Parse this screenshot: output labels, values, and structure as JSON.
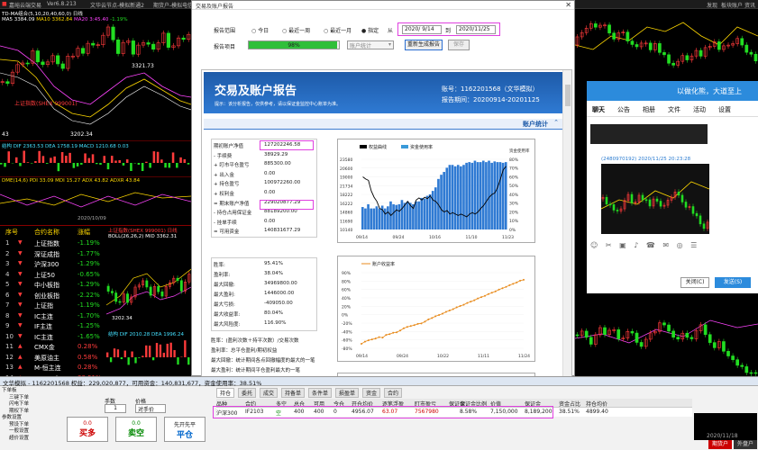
{
  "titlebar": {
    "app": "嘉峪云端交易",
    "version": "Ver6.8.213",
    "tab1": "文华云节点-模拟新通2",
    "tab2": "期货户-模拟电信",
    "dialog": "交易及账户报告",
    "right_links": [
      "发现",
      "板块",
      "账户",
      "资讯"
    ]
  },
  "left_chart": {
    "header": "TD-MA组合(5,10,20,40,60,0)  日线",
    "ma5": "MA5 3384.09",
    "ma10": "MA10 3362.84",
    "ma20": "MA20 3:45.40",
    "pct": "-1.19%",
    "index": "上证指数(SHEX 999001)",
    "price": "3321.73",
    "lbl1": "3202.34",
    "macd": "结构 DIF 2363.53  DEA 1758.19  MACD 1210.68  0.03",
    "macd_val": "43",
    "dmi": "DME(14,6)  PDI 33.09  MDI 15.27  ADX 43.82  ADXR 43.84",
    "date": "2020/10/09"
  },
  "watchlist": {
    "cols": [
      "序号",
      "合约名称",
      "涨幅"
    ],
    "rows": [
      {
        "n": "1",
        "name": "上证指数",
        "chg": "-1.19%"
      },
      {
        "n": "2",
        "name": "深证成指",
        "chg": "-1.77%"
      },
      {
        "n": "3",
        "name": "沪深300",
        "chg": "-1.29%"
      },
      {
        "n": "4",
        "name": "上证50",
        "chg": "-0.65%"
      },
      {
        "n": "5",
        "name": "中小板指",
        "chg": "-1.29%"
      },
      {
        "n": "6",
        "name": "创业板指",
        "chg": "-2.22%"
      },
      {
        "n": "7",
        "name": "上证指",
        "chg": "-1.19%"
      },
      {
        "n": "8",
        "name": "IC主连",
        "chg": "-1.70%"
      },
      {
        "n": "9",
        "name": "IF主连",
        "chg": "-1.25%"
      },
      {
        "n": "10",
        "name": "IC主连",
        "chg": "-1.65%"
      },
      {
        "n": "11",
        "name": "CMX金",
        "chg": "0.28%"
      },
      {
        "n": "12",
        "name": "美原油主",
        "chg": "0.58%"
      },
      {
        "n": "13",
        "name": "M-恒主连",
        "chg": "0.28%"
      },
      {
        "n": "14",
        "name": "M-Nas主",
        "chg": "38.51%"
      }
    ]
  },
  "mid_chart": {
    "index": "上证指数(SHEX 999001) 日线",
    "boll": "BOLL(26,26,2)  MID 3362.31",
    "lbl": "3202.34",
    "macd": "结构 DIF 2010.28  DEA 1996.24"
  },
  "dialog": {
    "range_label": "报告范围",
    "opt_today": "今日",
    "opt_week": "最近一周",
    "opt_month": "最近一月",
    "opt_custom": "指定",
    "from_label": "从",
    "from": "2020/ 9/14",
    "to_label": "到",
    "to": "2020/11/25",
    "item_label": "报告项目",
    "progress_text": "98%",
    "progress": 0.98,
    "combo": "账户统计",
    "gen_btn": "重新生成报告",
    "save_btn": "保存",
    "banner_title": "交易及账户报告",
    "banner_sub": "提示：该分析报告，仅供参考，请以保证金监控中心账单为准。",
    "acct_label": "账号：",
    "acct": "1162201568（文华模拟）",
    "period_label": "报告期间：",
    "period": "20200914-20201125",
    "section": "账户统计",
    "stats": [
      {
        "k": "期初账户净值",
        "v": "127202246.58"
      },
      {
        "k": "- 手续费",
        "v": "38929.29"
      },
      {
        "k": "+ 盯市平仓盈亏",
        "v": "885300.00"
      },
      {
        "k": "+ 出入金",
        "v": "0.00"
      },
      {
        "k": "+ 持仓盈亏",
        "v": "100972260.00"
      },
      {
        "k": "+ 权利金",
        "v": "0.00"
      },
      {
        "k": "= 期末账户净值",
        "v": "229020877.29"
      },
      {
        "k": "- 持仓占用保证金",
        "v": "88189200.00"
      },
      {
        "k": "- 挂单手续",
        "v": "0.00"
      },
      {
        "k": "= 可用资金",
        "v": "140831677.29"
      }
    ],
    "ratios": [
      {
        "k": "胜率:",
        "v": "95.41%"
      },
      {
        "k": "盈利率:",
        "v": "38.04%"
      },
      {
        "k": "最大回撤:",
        "v": "34969800.00"
      },
      {
        "k": "最大盈利:",
        "v": "1446000.00"
      },
      {
        "k": "最大亏损:",
        "v": "-409050.00"
      },
      {
        "k": "最大收益率:",
        "v": "80.04%"
      },
      {
        "k": "最大风险度:",
        "v": "116.90%"
      }
    ],
    "notes": [
      "胜率：(盈利次数＋持平次数）/交易次数",
      "盈利率：总平仓盈利/期初权益",
      "最大回撤：统计期间各点回撤幅度的最大的一笔",
      "最大盈利：统计期间平仓盈利最大的一笔"
    ]
  },
  "chart_data": [
    {
      "type": "bar",
      "legend": [
        "权益曲线",
        "资金使用率"
      ],
      "x": [
        "09/14",
        "09/24",
        "10/16",
        "11/10",
        "11/23"
      ],
      "y_left_ticks": [
        "23580",
        "20600",
        "19000",
        "21734",
        "18222",
        "16222",
        "14860",
        "11690",
        "10140"
      ],
      "y_right_ticks": [
        "资金使用率",
        "80%",
        "70%",
        "60%",
        "50%",
        "40%",
        "30%",
        "20%",
        "10%",
        "0%"
      ],
      "bars": [
        0.32,
        0.3,
        0.36,
        0.3,
        0.3,
        0.33,
        0.3,
        0.34,
        0.3,
        0.33,
        0.4,
        0.36,
        0.35,
        0.36,
        0.42,
        0.38,
        0.4,
        0.38,
        0.36,
        0.4,
        0.4,
        0.45,
        0.44,
        0.48,
        0.5,
        0.55,
        0.6,
        0.72,
        0.78,
        0.82,
        0.88,
        0.92,
        0.92,
        0.9,
        0.92,
        0.9,
        0.92,
        0.95,
        0.96,
        0.95,
        0.98,
        0.96,
        0.96,
        0.98,
        0.96,
        0.98,
        0.95,
        0.97,
        0.96,
        0.96,
        0.95,
        0.96
      ],
      "line": [
        0.75,
        0.72,
        0.7,
        0.55,
        0.46,
        0.4,
        0.3,
        0.28,
        0.22,
        0.25,
        0.2,
        0.24,
        0.28,
        0.26,
        0.3,
        0.35,
        0.4,
        0.34,
        0.3,
        0.42,
        0.45,
        0.42,
        0.46,
        0.44,
        0.48,
        0.42,
        0.4,
        0.35,
        0.28,
        0.25,
        0.27,
        0.22,
        0.24,
        0.22,
        0.2,
        0.22,
        0.2,
        0.18,
        0.22,
        0.24,
        0.22,
        0.25,
        0.3,
        0.34,
        0.4,
        0.46,
        0.5,
        0.52,
        0.6,
        0.72,
        0.85,
        0.9
      ]
    },
    {
      "type": "line",
      "title": "账户收益率",
      "x": [
        "09/14",
        "09/24",
        "10/22",
        "11/11",
        "11/24"
      ],
      "y_ticks": [
        "90%",
        "80%",
        "60%",
        "40%",
        "20%",
        "0%",
        "-20%",
        "-40%",
        "-60%",
        "-80%"
      ],
      "values": [
        -0.7,
        -0.65,
        -0.62,
        -0.6,
        -0.58,
        -0.55,
        -0.56,
        -0.5,
        -0.48,
        -0.45,
        -0.44,
        -0.4,
        -0.35,
        -0.32,
        -0.3,
        -0.28,
        -0.25,
        -0.24,
        -0.2,
        -0.15,
        -0.12,
        -0.08,
        -0.05,
        -0.02,
        0.02,
        0.05,
        0.08,
        0.12,
        0.15,
        0.18,
        0.22,
        0.25,
        0.28,
        0.32,
        0.35,
        0.38,
        0.42,
        0.45,
        0.48,
        0.52,
        0.55,
        0.58,
        0.62,
        0.65,
        0.68,
        0.72,
        0.74
      ]
    }
  ],
  "right_panel": {
    "title": "以做化熊，大道至上",
    "tabs": [
      "聊天",
      "公告",
      "相册",
      "文件",
      "活动",
      "设置"
    ],
    "msg1": "(2480970192) 2020/11/25 20:23:28",
    "msg2": "(2480970192) 2020/11/25 20:23:28",
    "close_btn": "关闭(C)",
    "send_btn": "发送(S)"
  },
  "bottom": {
    "title": "文华模拟 - 1162201568  权益：229,020,877，可用资金：140,831,677，资金使用率：38.51%",
    "tree": [
      "下单板",
      "三键下单",
      "闪电下单",
      "期权下单",
      "参数设置",
      "预设下单",
      "一般设置",
      "超价设置"
    ],
    "qty_label": "手数",
    "qty": "1",
    "price_label": "价格",
    "price": "对手价",
    "buy_price": "0.0",
    "buy_label": "买多",
    "sell_price": "0.0",
    "sell_label": "卖空",
    "close_label": "先开先平",
    "close_label2": "平仓",
    "tabs": [
      "持仓",
      "委托",
      "成交",
      "持备单",
      "条件单",
      "损盈单",
      "资金",
      "合约"
    ],
    "cols": [
      "品种",
      "合约",
      "多空",
      "总仓",
      "可用",
      "今仓",
      "开仓均价",
      "逐笔浮盈",
      "盯市盈亏",
      "保证金",
      "保证金比例",
      "价值",
      "保证金",
      "资金占比",
      "持仓均价"
    ],
    "row": [
      "沪深300",
      "IF2103",
      "空",
      "400",
      "400",
      "0",
      "4956.07",
      "63.07",
      "7567980",
      "",
      "8.58%",
      "7,150,000",
      "8,189,200",
      "38.51%",
      "4899.40"
    ],
    "bottom_btns": [
      "期货户",
      "外盘户"
    ],
    "date": "2020/11/18"
  }
}
